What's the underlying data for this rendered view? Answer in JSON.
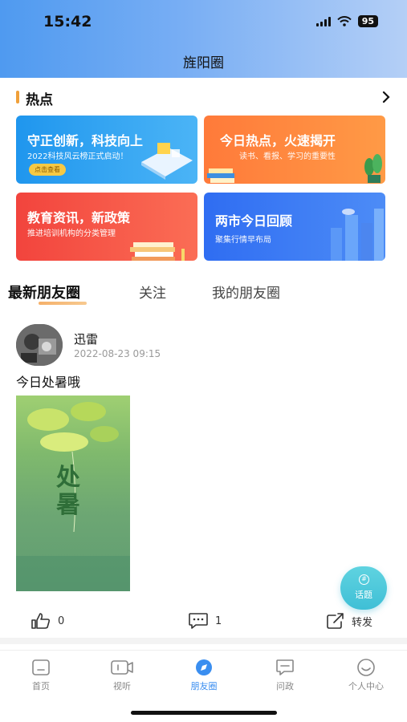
{
  "status": {
    "time": "15:42",
    "battery": "95"
  },
  "page": {
    "title": "旌阳圈"
  },
  "hot": {
    "title": "热点",
    "cards": [
      {
        "title": "守正创新，科技向上",
        "subtitle": "2022科技风云榜正式启动！",
        "button": "点击查看"
      },
      {
        "title": "今日热点，火速揭开",
        "subtitle": "读书、看报、学习的重要性"
      },
      {
        "title": "教育资讯，新政策",
        "subtitle": "推进培训机构的分类管理"
      },
      {
        "title": "两市今日回顾",
        "subtitle": "聚集行情早布局"
      }
    ]
  },
  "tabs": [
    {
      "label": "最新朋友圈",
      "active": true
    },
    {
      "label": "关注",
      "active": false
    },
    {
      "label": "我的朋友圈",
      "active": false
    }
  ],
  "post": {
    "user": "迅雷",
    "time": "2022-08-23 09:15",
    "text": "今日处暑哦",
    "image_text": "处暑",
    "likes": "0",
    "comments": "1",
    "share_label": "转发"
  },
  "fab": {
    "label": "话题"
  },
  "bottom_nav": [
    {
      "label": "首页",
      "icon": "home-icon",
      "active": false
    },
    {
      "label": "视听",
      "icon": "video-icon",
      "active": false
    },
    {
      "label": "朋友圈",
      "icon": "compass-icon",
      "active": true
    },
    {
      "label": "问政",
      "icon": "chat-icon",
      "active": false
    },
    {
      "label": "个人中心",
      "icon": "smile-icon",
      "active": false
    }
  ],
  "colors": {
    "accent": "#3a8ef0",
    "tab_underline": "#f5b06a",
    "fab": "#4fc8dc"
  }
}
